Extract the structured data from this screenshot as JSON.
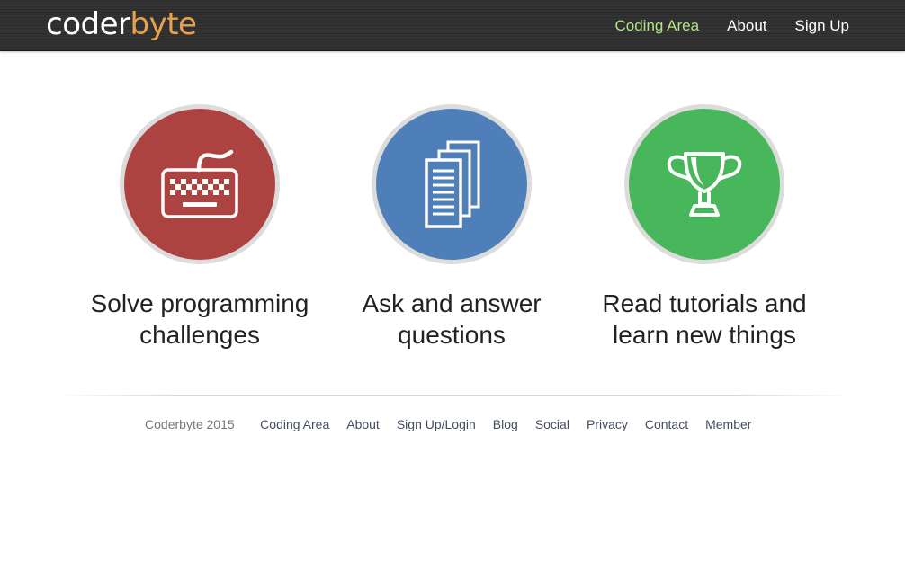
{
  "header": {
    "logo_part1": "coder",
    "logo_part2": "byte",
    "nav": [
      {
        "label": "Coding Area",
        "active": true
      },
      {
        "label": "About"
      },
      {
        "label": "Sign Up"
      }
    ]
  },
  "features": [
    {
      "icon": "keyboard-icon",
      "color": "#ad4341",
      "line1": "Solve programming",
      "line2": "challenges"
    },
    {
      "icon": "documents-icon",
      "color": "#4f7fb8",
      "line1": "Ask and answer",
      "line2": "questions"
    },
    {
      "icon": "trophy-icon",
      "color": "#48b65b",
      "line1": "Read tutorials and",
      "line2": "learn new things"
    }
  ],
  "footer": {
    "copyright": "Coderbyte 2015",
    "links": [
      "Coding Area",
      "About",
      "Sign Up/Login",
      "Blog",
      "Social",
      "Privacy",
      "Contact",
      "Member"
    ]
  },
  "colors": {
    "accent_orange": "#e8a24f",
    "nav_active_green": "#b2e483",
    "topbar": "#303030"
  }
}
